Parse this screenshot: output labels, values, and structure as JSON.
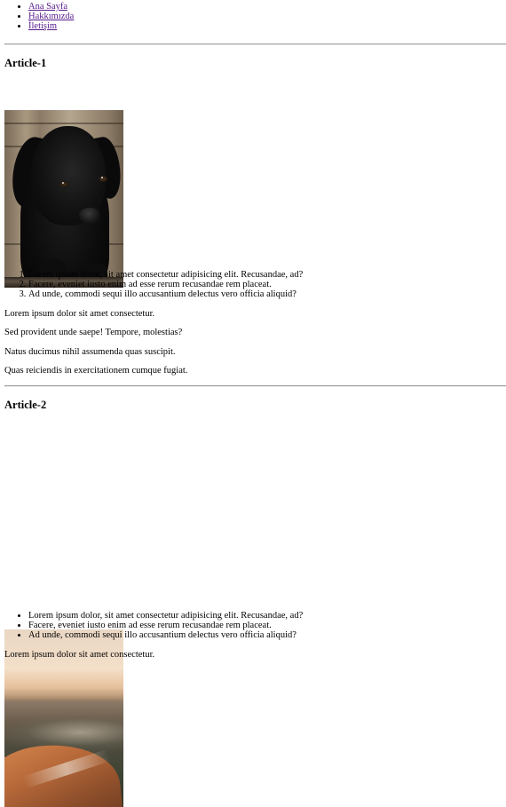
{
  "nav": {
    "items": [
      "Ana Sayfa",
      "Hakkımızda",
      "İletişim"
    ]
  },
  "article1": {
    "title": "Article-1",
    "image": "black puppy photo",
    "list_type": "ordered",
    "list": [
      "Lorem ipsum dolor, sit amet consectetur adipisicing elit. Recusandae, ad?",
      "Facere, eveniet iusto enim ad esse rerum recusandae rem placeat.",
      "Ad unde, commodi sequi illo accusantium delectus vero officia aliquid?"
    ],
    "paragraphs": [
      "Lorem ipsum dolor sit amet consectetur.",
      "Sed provident unde saepe! Tempore, molestias?",
      "Natus ducimus nihil assumenda quas suscipit.",
      "Quas reiciendis in exercitationem cumque fugiat."
    ]
  },
  "article2": {
    "title": "Article-2",
    "image": "sea waves and rock photo",
    "list_type": "unordered",
    "list": [
      "Lorem ipsum dolor, sit amet consectetur adipisicing elit. Recusandae, ad?",
      "Facere, eveniet iusto enim ad esse rerum recusandae rem placeat.",
      "Ad unde, commodi sequi illo accusantium delectus vero officia aliquid?"
    ],
    "paragraphs": [
      "Lorem ipsum dolor sit amet consectetur."
    ]
  },
  "colors": {
    "link": "#551a8b",
    "rule": "#9a9a9a"
  }
}
